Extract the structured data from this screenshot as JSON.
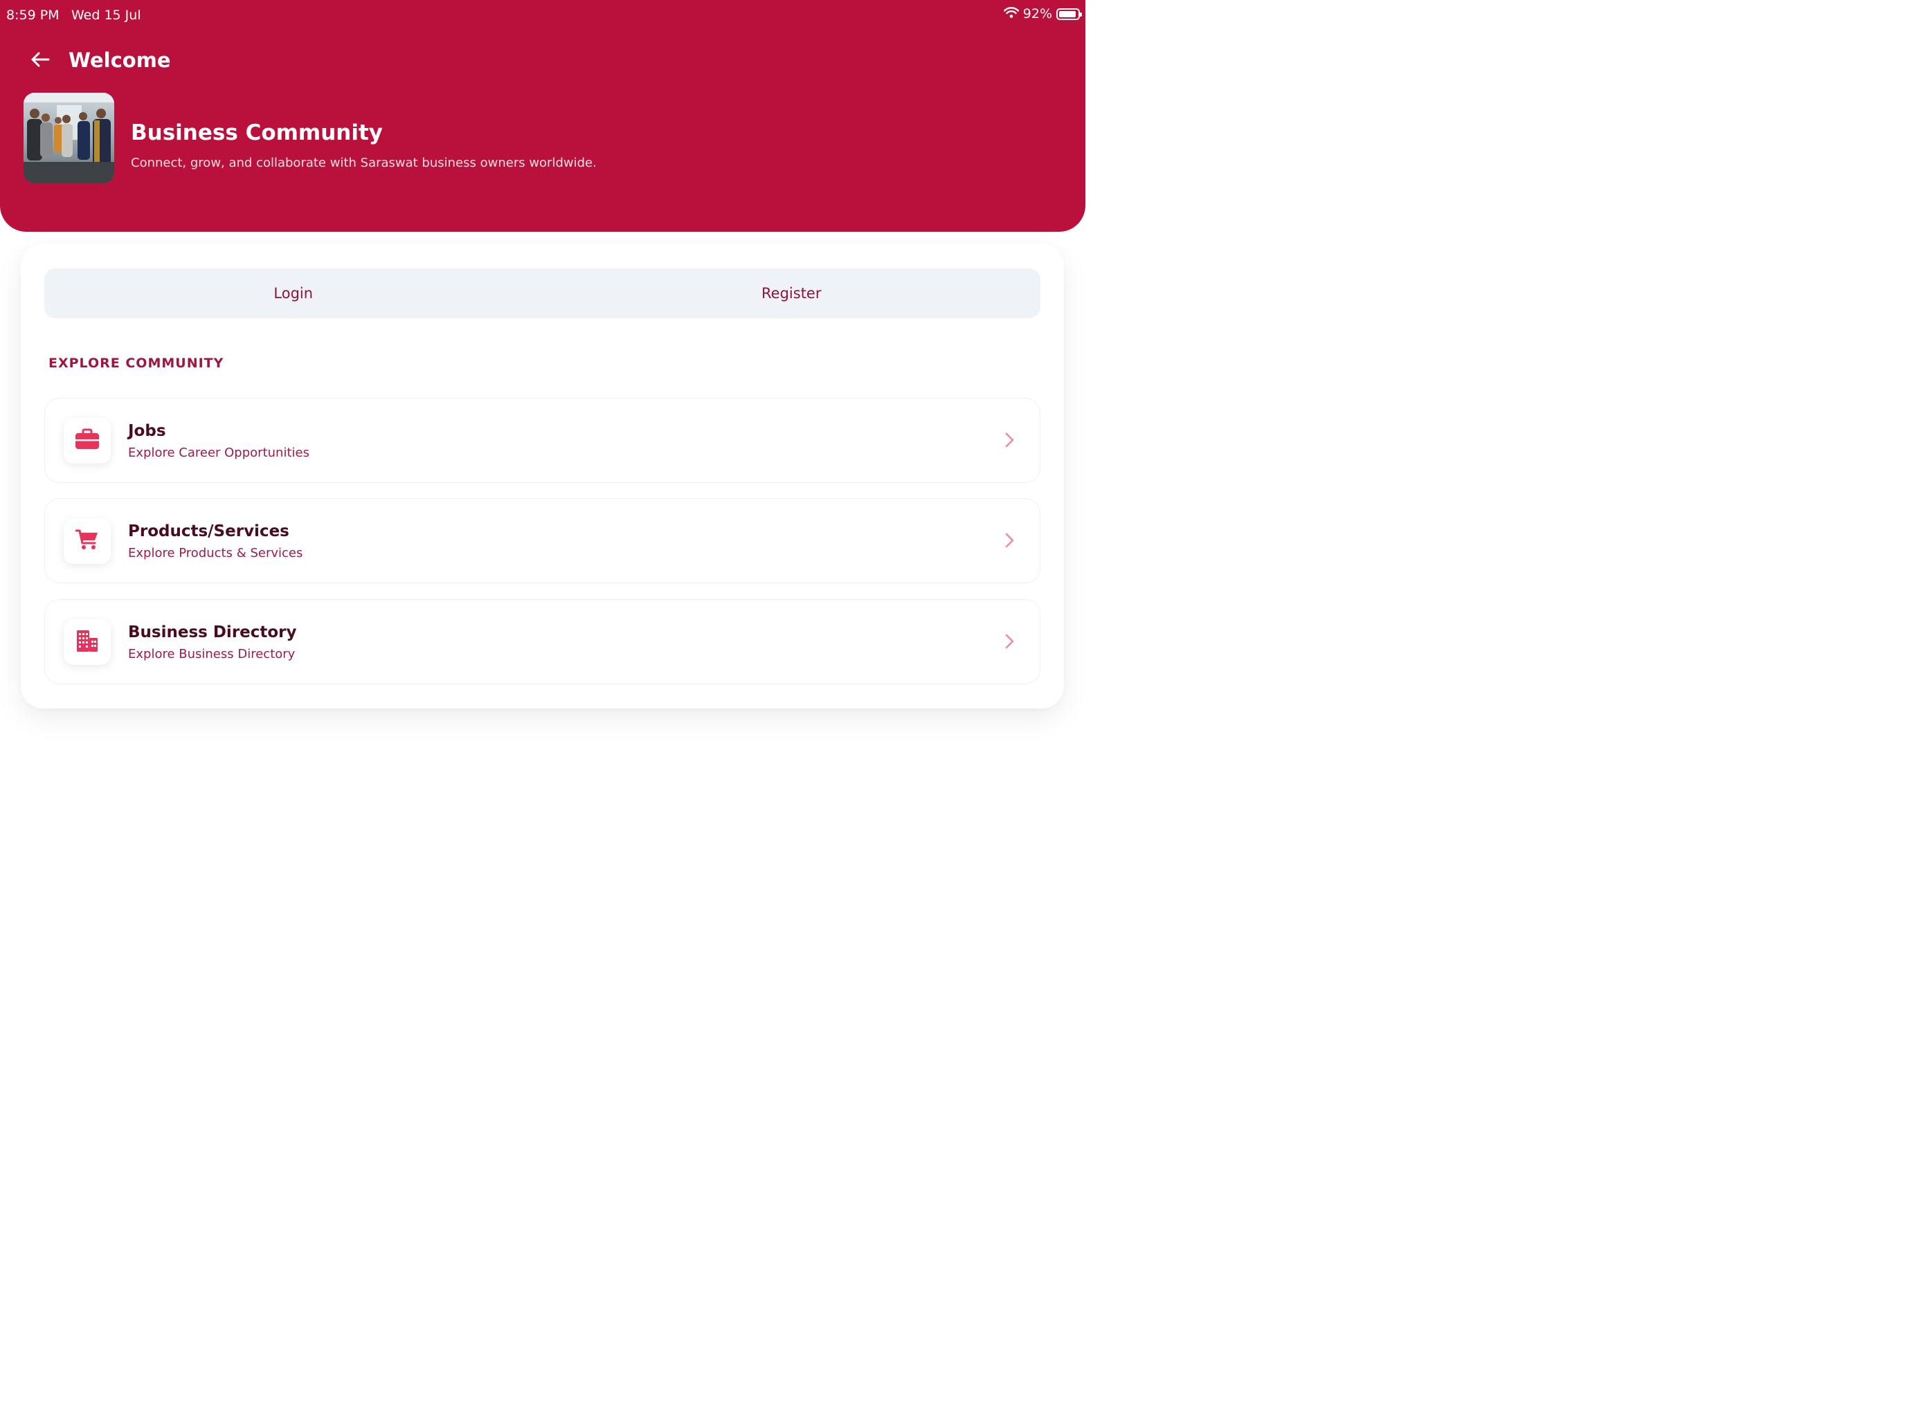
{
  "status_bar": {
    "time": "8:59 PM",
    "date": "Wed 15 Jul",
    "battery": "92%",
    "battery_level": 0.92,
    "wifi_icon": "wifi-icon"
  },
  "header": {
    "title": "Welcome",
    "back_icon": "arrow-left-icon"
  },
  "hero": {
    "title": "Business Community",
    "subtitle": "Connect, grow, and collaborate with Saraswat business owners worldwide."
  },
  "tabs": [
    {
      "label": "Login"
    },
    {
      "label": "Register"
    }
  ],
  "section": {
    "heading": "EXPLORE COMMUNITY"
  },
  "items": [
    {
      "title": "Jobs",
      "subtitle": "Explore Career Opportunities",
      "icon": "briefcase-icon"
    },
    {
      "title": "Products/Services",
      "subtitle": "Explore Products & Services",
      "icon": "cart-icon"
    },
    {
      "title": "Business Directory",
      "subtitle": "Explore Business Directory",
      "icon": "building-icon"
    }
  ],
  "colors": {
    "brand": "#ba103c",
    "accent": "#e8345a",
    "tab_background": "#eff3f8"
  }
}
